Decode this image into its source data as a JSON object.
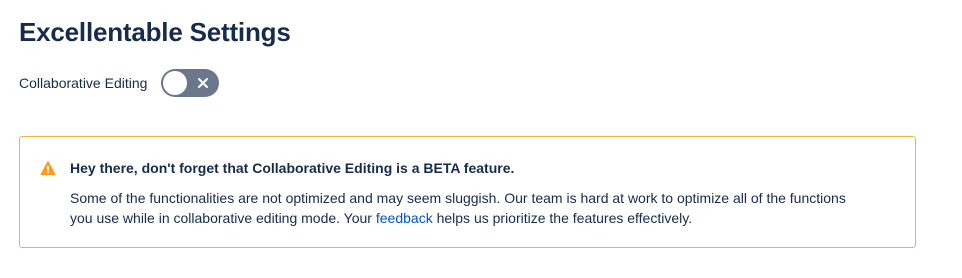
{
  "page": {
    "title": "Excellentable Settings"
  },
  "setting": {
    "label": "Collaborative Editing",
    "toggle_state": "off",
    "toggle_icon": "close-icon",
    "toggle_color": "#6b778c"
  },
  "banner": {
    "icon": "warning-icon",
    "border_color": "#f0b442",
    "icon_color": "#ff991f",
    "heading": "Hey there, don't forget that Collaborative Editing is a BETA feature.",
    "line1": "Some of the functionalities are not optimized and may seem sluggish. Our team is hard at work to optimize all of the functions",
    "line2_before": "you use while in collaborative editing mode. Your ",
    "link_text": "feedback",
    "line2_after": " helps us prioritize the features effectively.",
    "link_color": "#0052cc"
  }
}
